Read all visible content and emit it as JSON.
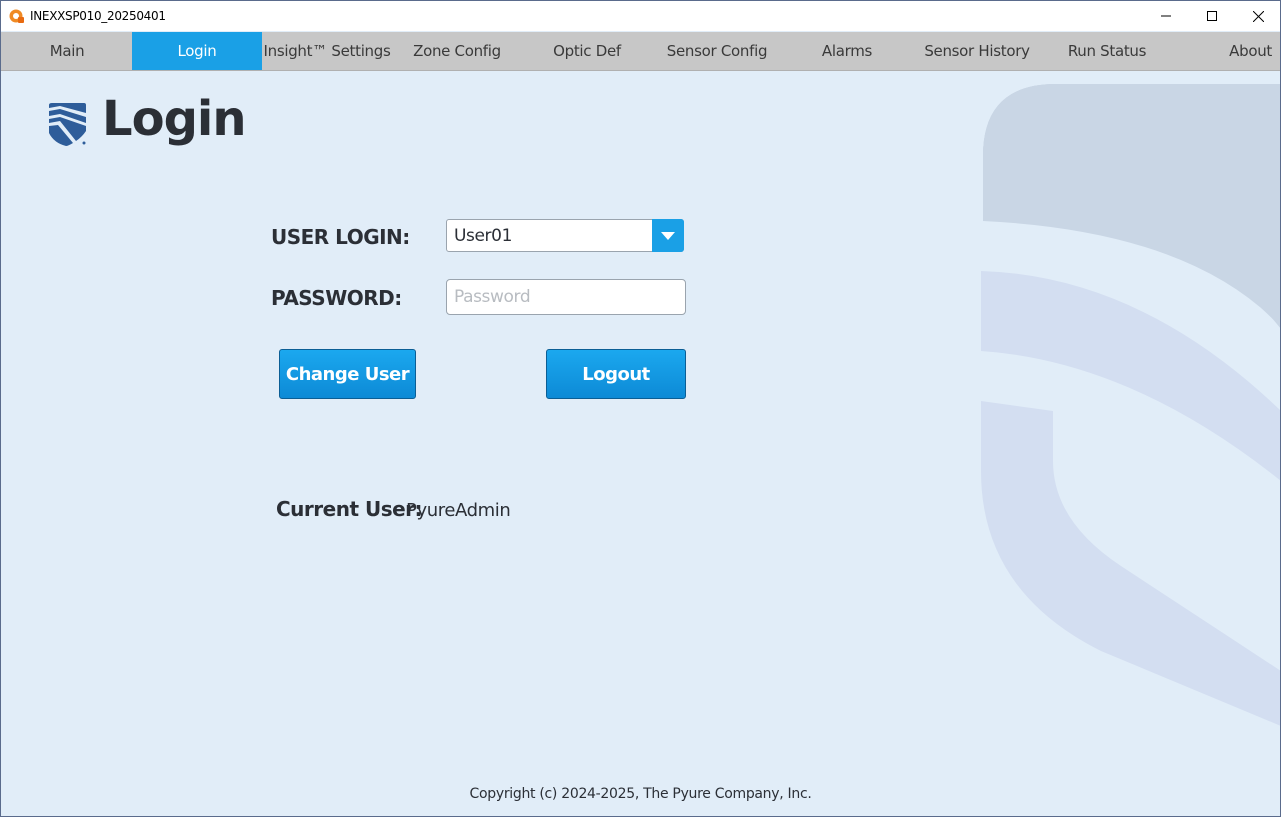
{
  "window": {
    "title": "INEXXSP010_20250401"
  },
  "tabs": [
    {
      "label": "Main",
      "active": false
    },
    {
      "label": "Login",
      "active": true
    },
    {
      "label": "Insight™ Settings",
      "active": false
    },
    {
      "label": "Zone Config",
      "active": false
    },
    {
      "label": "Optic Def",
      "active": false
    },
    {
      "label": "Sensor Config",
      "active": false
    },
    {
      "label": "Alarms",
      "active": false
    },
    {
      "label": "Sensor History",
      "active": false
    },
    {
      "label": "Run Status",
      "active": false
    },
    {
      "label": "About",
      "active": false
    }
  ],
  "page": {
    "title": "Login"
  },
  "form": {
    "user_login_label": "USER LOGIN:",
    "user_login_value": "User01",
    "password_label": "PASSWORD:",
    "password_placeholder": "Password",
    "password_value": ""
  },
  "buttons": {
    "change_user": "Change User",
    "logout": "Logout"
  },
  "current_user": {
    "label": "Current User:",
    "value": "PyureAdmin"
  },
  "footer": {
    "copyright": "Copyright (c) 2024-2025, The Pyure Company, Inc."
  },
  "colors": {
    "accent": "#1aa0e6",
    "background": "#e1edf8",
    "tabbar": "#c7c7c7",
    "logo": "#2e5d9a"
  },
  "icons": {
    "app": "app-logo-icon",
    "minimize": "minimize-icon",
    "maximize": "maximize-icon",
    "close": "close-icon",
    "dropdown": "chevron-down-icon",
    "brand": "shield-logo-icon"
  }
}
